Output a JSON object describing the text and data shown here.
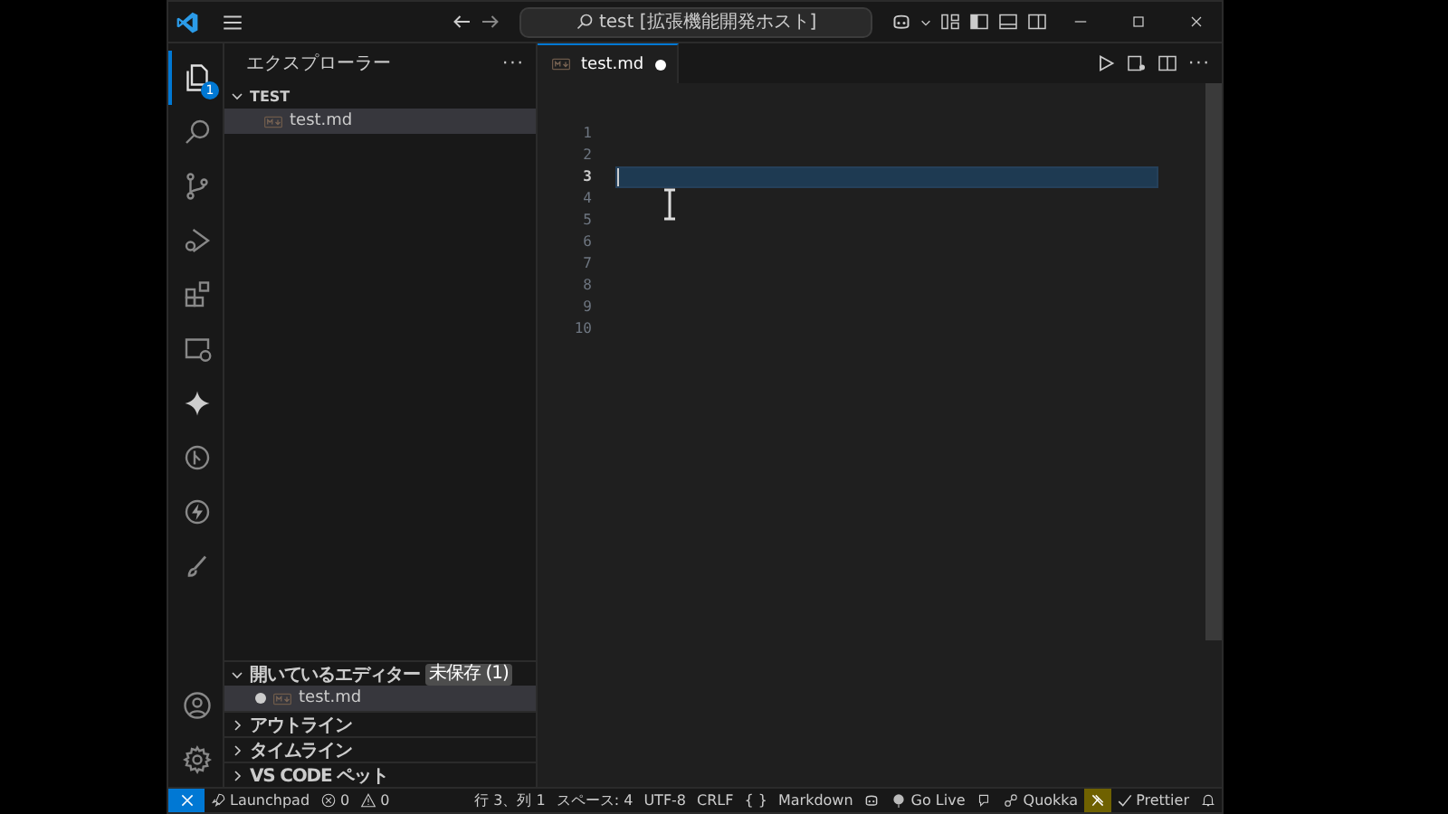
{
  "title_bar": {
    "command_center": "test [拡張機能開発ホスト]"
  },
  "activity_bar": {
    "top": [
      {
        "kind": "files",
        "selected": true,
        "badge": "1"
      },
      {
        "kind": "search",
        "selected": false
      },
      {
        "kind": "branch",
        "selected": false
      },
      {
        "kind": "debug",
        "selected": false
      },
      {
        "kind": "extensions",
        "selected": false
      },
      {
        "kind": "remote",
        "selected": false
      },
      {
        "kind": "sparkle",
        "selected": false
      },
      {
        "kind": "gitcircle",
        "selected": false
      },
      {
        "kind": "bolt",
        "selected": false
      },
      {
        "kind": "brush",
        "selected": false
      }
    ],
    "bottom": [
      {
        "kind": "account",
        "selected": false
      },
      {
        "kind": "gear",
        "selected": false
      }
    ]
  },
  "sidebar": {
    "title": "エクスプローラー",
    "more": "···",
    "folder": {
      "label": "TEST",
      "expanded": true,
      "children": [
        {
          "name": "test.md",
          "selected": true
        }
      ]
    },
    "sections": [
      {
        "label": "開いているエディター",
        "badge": "未保存 (1)",
        "expanded": true,
        "items": [
          {
            "name": "test.md",
            "modified": true
          }
        ]
      },
      {
        "label": "アウトライン",
        "expanded": false
      },
      {
        "label": "タイムライン",
        "expanded": false
      },
      {
        "label": "VS CODE ペット",
        "expanded": false
      }
    ]
  },
  "tabs": [
    {
      "label": "test.md",
      "selected": true,
      "modified": true
    }
  ],
  "editor": {
    "lines": [
      {
        "number": "1",
        "current": false
      },
      {
        "number": "2",
        "current": false
      },
      {
        "number": "3",
        "current": true
      },
      {
        "number": "4",
        "current": false
      },
      {
        "number": "5",
        "current": false
      },
      {
        "number": "6",
        "current": false
      },
      {
        "number": "7",
        "current": false
      },
      {
        "number": "8",
        "current": false
      },
      {
        "number": "9",
        "current": false
      },
      {
        "number": "10",
        "current": false
      }
    ]
  },
  "status_bar": {
    "left": [
      {
        "kind": "launchpad",
        "text": "Launchpad"
      },
      {
        "kind": "errors",
        "text": "0"
      },
      {
        "kind": "warnings",
        "text": "0"
      }
    ],
    "right": [
      {
        "kind": "text",
        "text": "行 3、列 1",
        "highlighted": false
      },
      {
        "kind": "text",
        "text": "スペース: 4",
        "highlighted": false
      },
      {
        "kind": "text",
        "text": "UTF-8",
        "highlighted": false
      },
      {
        "kind": "text",
        "text": "CRLF",
        "highlighted": false
      },
      {
        "kind": "text",
        "text": "{ }",
        "highlighted": false
      },
      {
        "kind": "text",
        "text": "Markdown",
        "highlighted": false
      },
      {
        "kind": "copilot",
        "highlighted": false
      },
      {
        "kind": "golive",
        "text": "Go Live",
        "highlighted": false
      },
      {
        "kind": "feedback",
        "highlighted": false
      },
      {
        "kind": "quokka",
        "text": "Quokka",
        "highlighted": false
      },
      {
        "kind": "pin",
        "highlighted": true
      },
      {
        "kind": "prettier",
        "text": "Prettier",
        "highlighted": false
      },
      {
        "kind": "bell",
        "highlighted": false
      }
    ]
  }
}
